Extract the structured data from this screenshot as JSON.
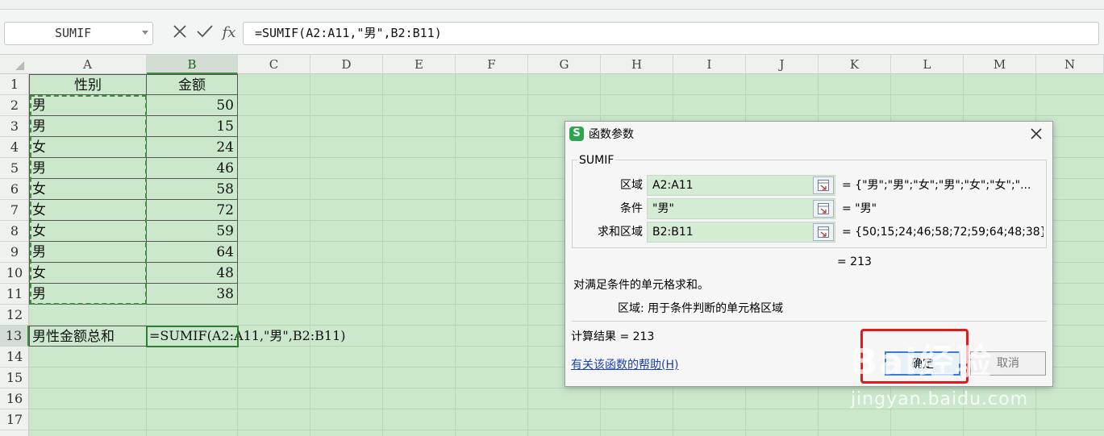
{
  "formula_bar": {
    "name_box": "SUMIF",
    "cancel_icon": "x-icon",
    "confirm_icon": "check-icon",
    "fx_label": "fx",
    "formula": "=SUMIF(A2:A11,\"男\",B2:B11)"
  },
  "columns": [
    "A",
    "B",
    "C",
    "D",
    "E",
    "F",
    "G",
    "H",
    "I",
    "J",
    "K",
    "L",
    "M",
    "N"
  ],
  "rows": [
    "1",
    "2",
    "3",
    "4",
    "5",
    "6",
    "7",
    "8",
    "9",
    "10",
    "11",
    "12",
    "13",
    "14",
    "15",
    "16",
    "17"
  ],
  "table": {
    "header_a": "性别",
    "header_b": "金额",
    "gender": [
      "男",
      "男",
      "女",
      "男",
      "女",
      "女",
      "女",
      "男",
      "女",
      "男"
    ],
    "amount": [
      "50",
      "15",
      "24",
      "46",
      "58",
      "72",
      "59",
      "64",
      "48",
      "38"
    ]
  },
  "summary": {
    "label": "男性金额总和",
    "formula": "=SUMIF(A2:A11,\"男\",B2:B11)"
  },
  "dialog": {
    "title": "函数参数",
    "function_name": "SUMIF",
    "params": [
      {
        "label": "区域",
        "value": "A2:A11",
        "result": "= {\"男\";\"男\";\"女\";\"男\";\"女\";\"女\";\"..."
      },
      {
        "label": "条件",
        "value": "\"男\"",
        "result": "= \"男\""
      },
      {
        "label": "求和区域",
        "value": "B2:B11",
        "result": "= {50;15;24;46;58;72;59;64;48;38}"
      }
    ],
    "total": "= 213",
    "description": "对满足条件的单元格求和。",
    "param_hint": "区域:  用于条件判断的单元格区域",
    "calc_result": "计算结果 = 213",
    "help_link": "有关该函数的帮助(H)",
    "ok_label": "确定",
    "cancel_label": "取消"
  },
  "watermark": {
    "logo": "Bai经验",
    "url": "jingyan.baidu.com"
  }
}
